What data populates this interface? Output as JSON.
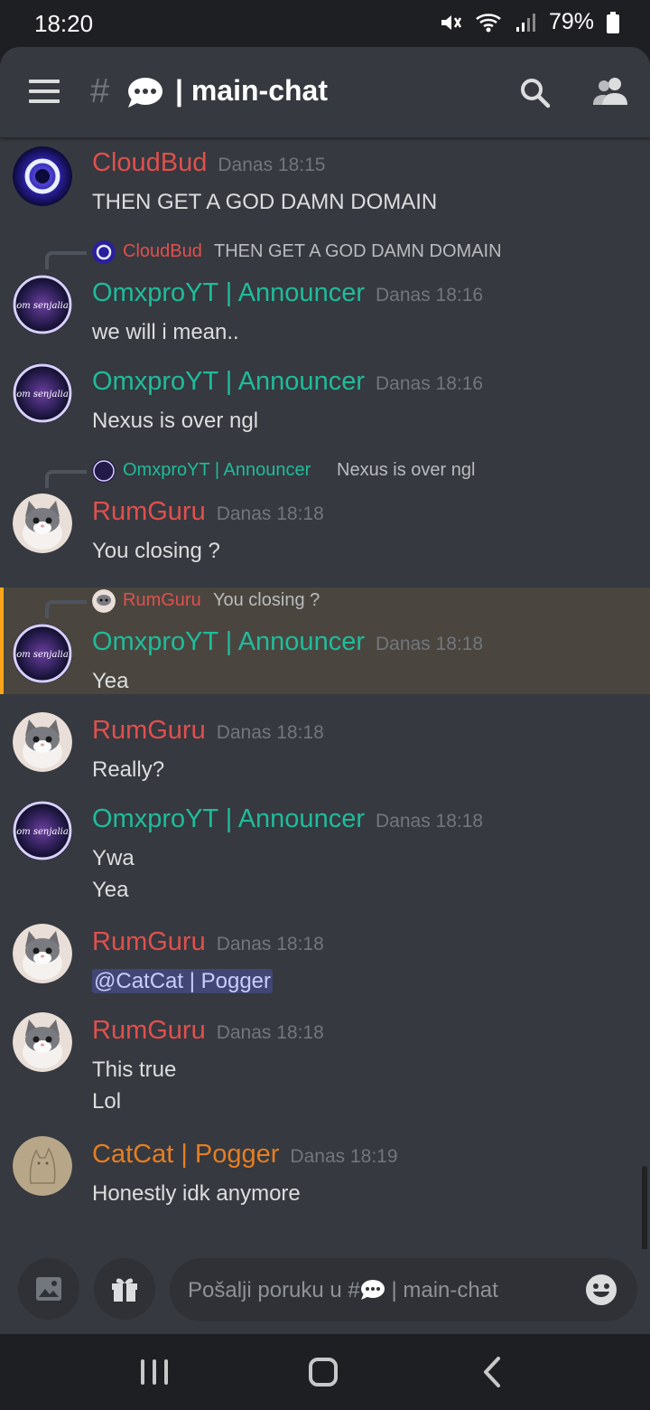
{
  "status": {
    "time": "18:20",
    "battery": "79%"
  },
  "header": {
    "hash": "#",
    "divider": "|",
    "channel": "main-chat"
  },
  "messages": [
    {
      "author": "CloudBud",
      "time": "Danas 18:15",
      "lines": [
        "THEN GET A GOD DAMN DOMAIN"
      ],
      "author_color": "#e0504d"
    },
    {
      "reply": {
        "author": "CloudBud",
        "text": "THEN GET A GOD DAMN DOMAIN"
      },
      "author": "OmxproYT | Announcer",
      "time": "Danas 18:16",
      "lines": [
        "we will i mean.."
      ]
    },
    {
      "author": "OmxproYT | Announcer",
      "time": "Danas 18:16",
      "lines": [
        "Nexus is over ngl"
      ]
    },
    {
      "reply": {
        "author": "OmxproYT | Announcer",
        "text": "Nexus is over ngl"
      },
      "author": "RumGuru",
      "time": "Danas 18:18",
      "lines": [
        "You closing ?"
      ]
    },
    {
      "reply": {
        "author": "RumGuru",
        "text": "You closing ?"
      },
      "author": "OmxproYT | Announcer",
      "time": "Danas 18:18",
      "lines": [
        "Yea"
      ],
      "highlighted": true
    },
    {
      "author": "RumGuru",
      "time": "Danas 18:18",
      "lines": [
        "Really?"
      ]
    },
    {
      "author": "OmxproYT | Announcer",
      "time": "Danas 18:18",
      "lines": [
        "Ywa",
        "Yea"
      ]
    },
    {
      "author": "RumGuru",
      "time": "Danas 18:18",
      "lines": [
        "@CatCat | Pogger"
      ]
    },
    {
      "author": "RumGuru",
      "time": "Danas 18:18",
      "lines": [
        "This true",
        "Lol"
      ]
    },
    {
      "author": "CatCat | Pogger",
      "time": "Danas 18:19",
      "lines": [
        "Honestly idk anymore"
      ]
    }
  ],
  "avatar_text": "om senjalia",
  "composer": {
    "placeholder_prefix": "Pošalji poruku u #",
    "placeholder_suffix": "| main-chat"
  },
  "colors": {
    "red_role": "#e0504d",
    "teal_role": "#1fbc9c",
    "orange_role": "#e67e22",
    "highlight_bar": "#faa61a"
  },
  "icons": [
    "menu-icon",
    "search-icon",
    "members-icon",
    "image-icon",
    "gift-icon",
    "emoji-icon",
    "recent-apps-icon",
    "home-icon",
    "back-icon"
  ]
}
